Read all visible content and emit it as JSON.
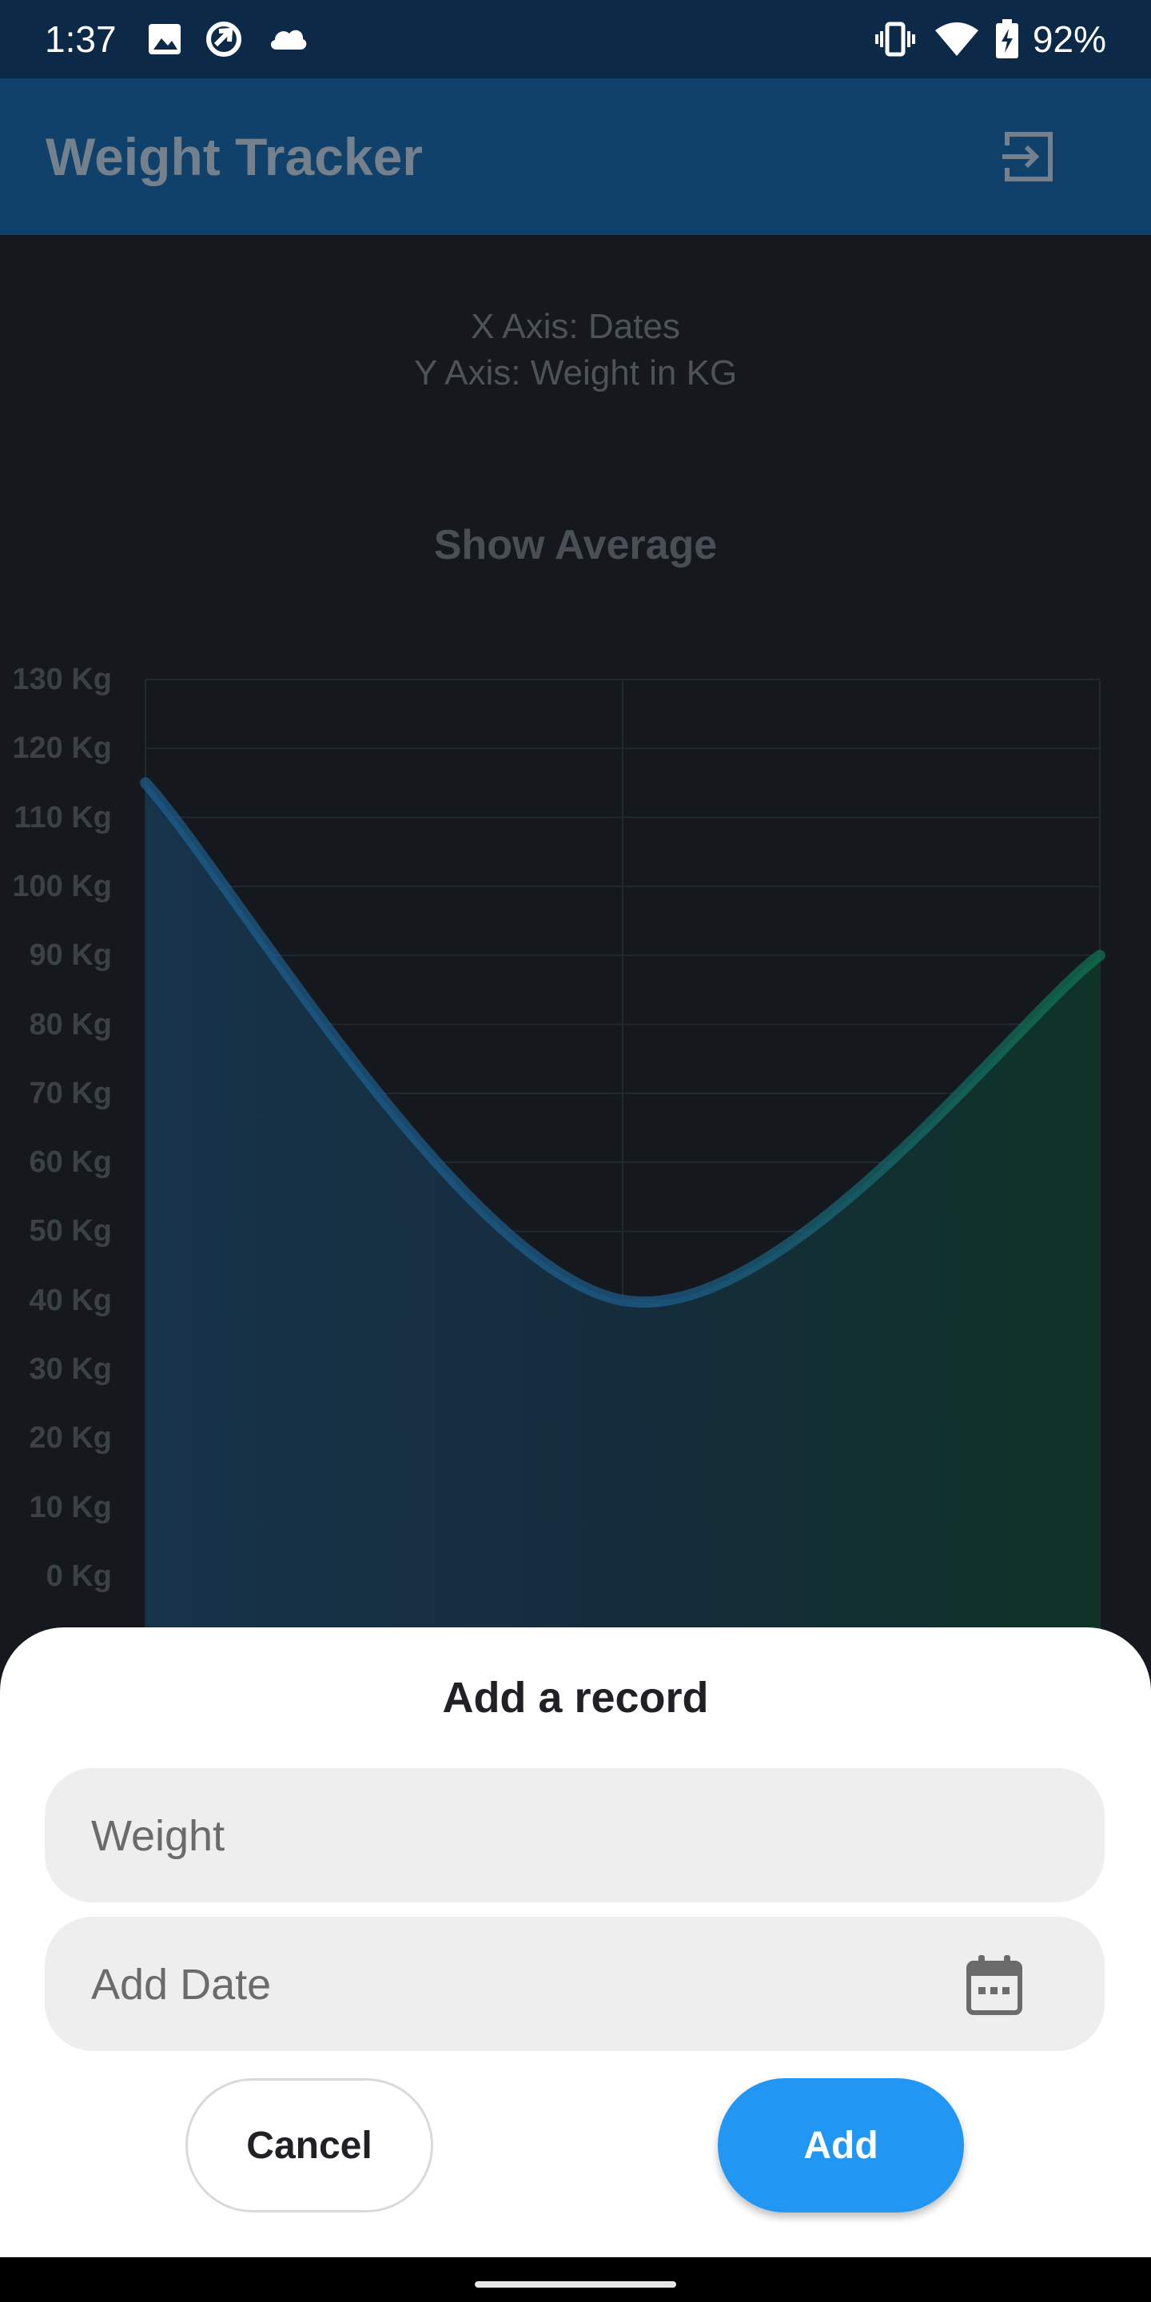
{
  "status_bar": {
    "time": "1:37",
    "battery": "92%",
    "left_icons": [
      "image-icon",
      "sync-icon",
      "cloud-icon"
    ],
    "right_icons": [
      "vibrate-icon",
      "wifi-icon",
      "battery-charging-icon"
    ]
  },
  "app_bar": {
    "title": "Weight Tracker",
    "action_icon": "logout-icon"
  },
  "axis_info": {
    "x_axis": "X Axis: Dates",
    "y_axis": "Y Axis: Weight in KG"
  },
  "show_average_label": "Show Average",
  "chart_data": {
    "type": "area",
    "xlabel": "",
    "ylabel": "",
    "ylim": [
      0,
      130
    ],
    "y_ticks": [
      "130 Kg",
      "120 Kg",
      "110 Kg",
      "100 Kg",
      "90 Kg",
      "80 Kg",
      "70 Kg",
      "60 Kg",
      "50 Kg",
      "40 Kg",
      "30 Kg",
      "20 Kg",
      "10 Kg",
      "0 Kg"
    ],
    "series": [
      {
        "values": [
          115,
          40,
          90
        ]
      }
    ],
    "curve": "smooth",
    "grid": true,
    "gradient_colors": [
      "#1d6aa0",
      "#10845a"
    ]
  },
  "sheet": {
    "title": "Add a record",
    "weight_placeholder": "Weight",
    "date_placeholder": "Add Date",
    "date_icon": "calendar-icon",
    "cancel_label": "Cancel",
    "add_label": "Add"
  },
  "colors": {
    "status_bar": "#0c2a48",
    "app_bar": "#0f416b",
    "background": "#15181d",
    "primary_button": "#2196f3"
  }
}
